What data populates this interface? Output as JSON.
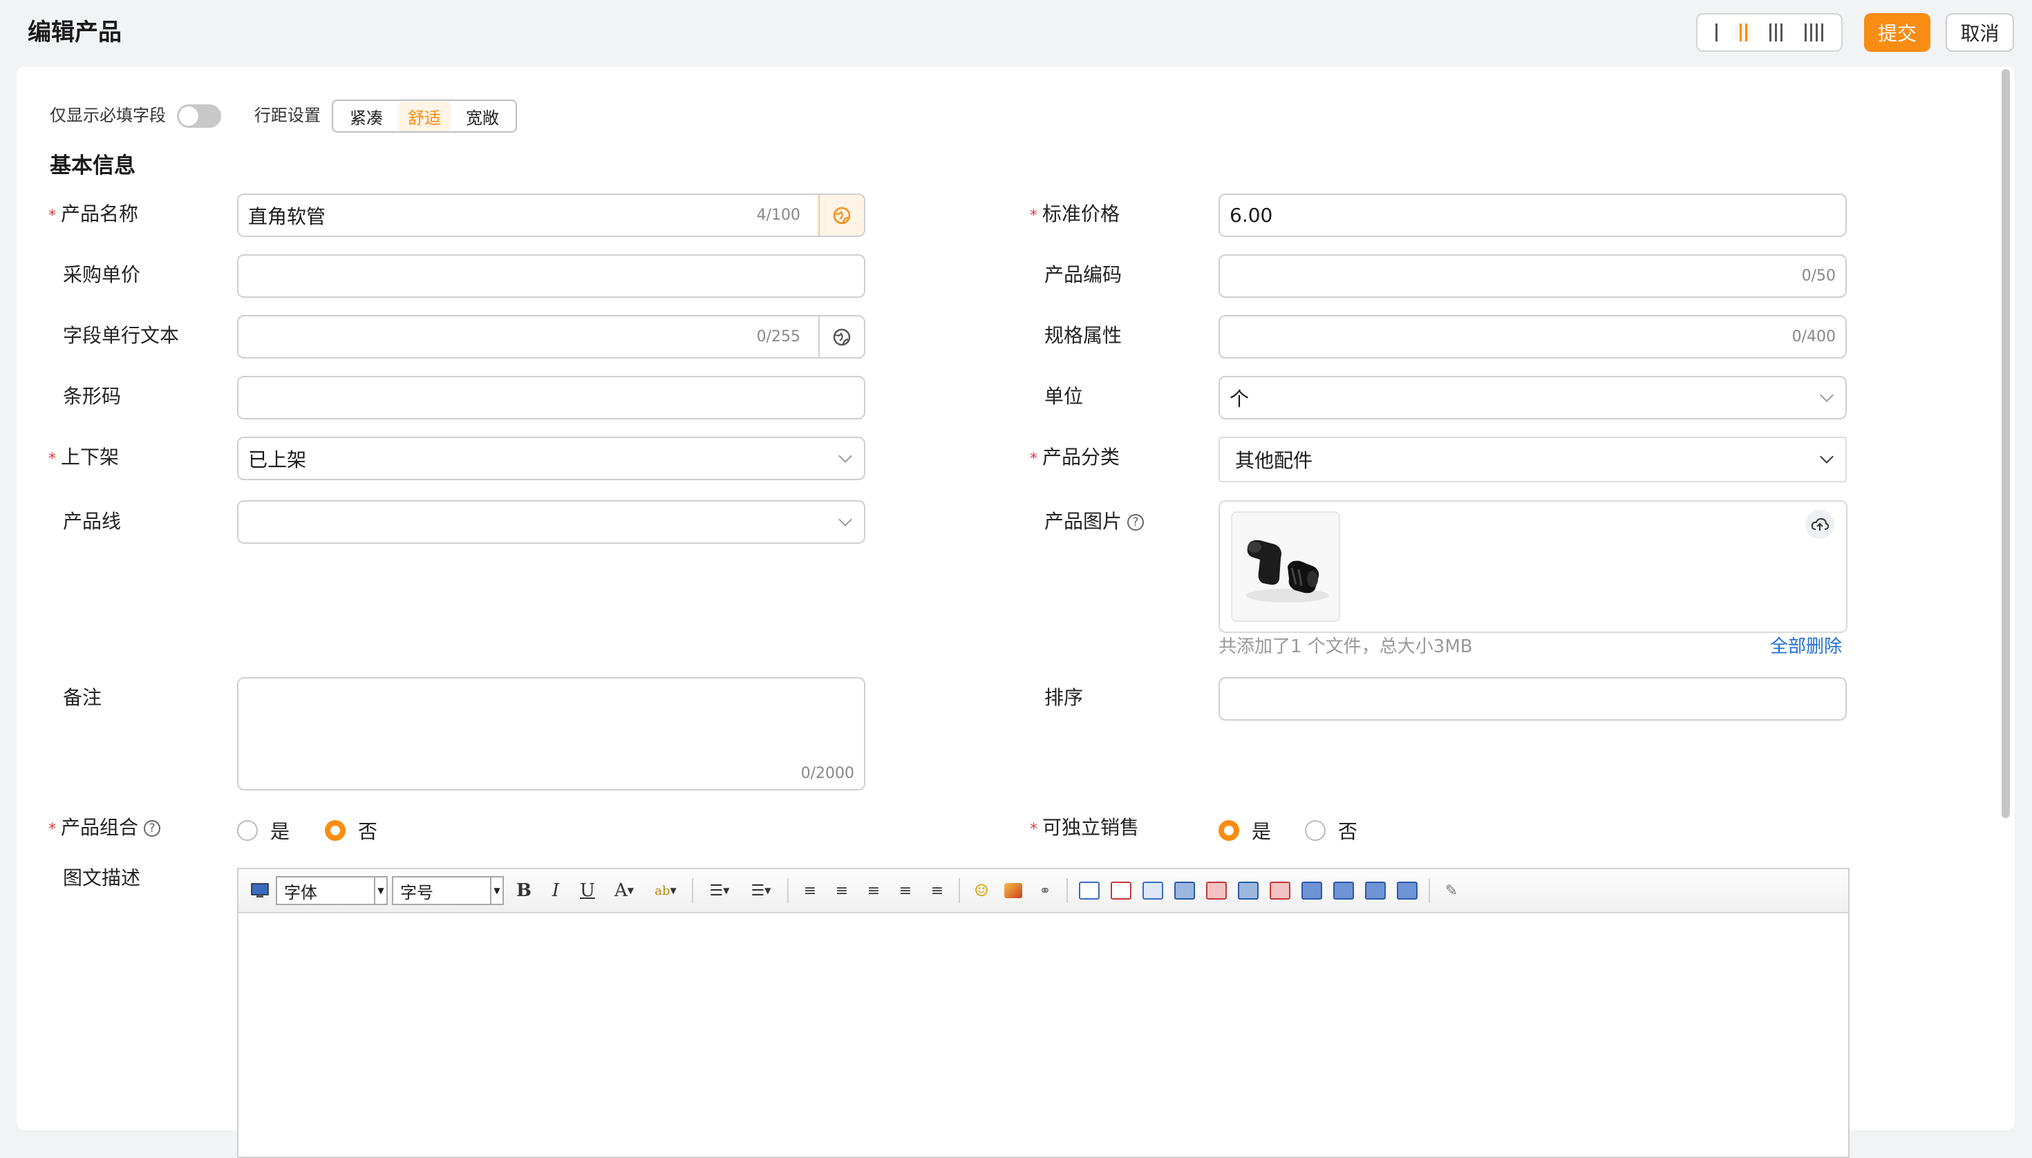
{
  "header": {
    "title": "编辑产品",
    "submit_label": "提交",
    "cancel_label": "取消"
  },
  "options": {
    "required_only_label": "仅显示必填字段",
    "spacing_label": "行距设置",
    "spacing_options": [
      "紧凑",
      "舒适",
      "宽敞"
    ],
    "spacing_selected": "舒适"
  },
  "section": {
    "title": "基本信息"
  },
  "fields": {
    "product_name": {
      "label": "产品名称",
      "value": "直角软管",
      "count": "4/100"
    },
    "purchase_price": {
      "label": "采购单价",
      "value": ""
    },
    "single_line_text": {
      "label": "字段单行文本",
      "value": "",
      "count": "0/255"
    },
    "barcode": {
      "label": "条形码",
      "value": ""
    },
    "listing_status": {
      "label": "上下架",
      "value": "已上架"
    },
    "product_line": {
      "label": "产品线",
      "value": ""
    },
    "remark": {
      "label": "备注",
      "value": "",
      "count": "0/2000"
    },
    "product_combo": {
      "label": "产品组合",
      "options": [
        "是",
        "否"
      ],
      "selected": "否"
    },
    "rich_description": {
      "label": "图文描述"
    },
    "standard_price": {
      "label": "标准价格",
      "value": "6.00"
    },
    "product_code": {
      "label": "产品编码",
      "value": "",
      "count": "0/50"
    },
    "spec_attr": {
      "label": "规格属性",
      "value": "",
      "count": "0/400"
    },
    "unit": {
      "label": "单位",
      "value": "个"
    },
    "category": {
      "label": "产品分类",
      "value": "其他配件"
    },
    "product_image": {
      "label": "产品图片",
      "file_info": "共添加了1 个文件，总大小3MB",
      "delete_all": "全部删除"
    },
    "sort_order": {
      "label": "排序",
      "value": ""
    },
    "sell_separately": {
      "label": "可独立销售",
      "options": [
        "是",
        "否"
      ],
      "selected": "是"
    }
  },
  "editor": {
    "font_placeholder": "字体",
    "size_placeholder": "字号"
  },
  "colors": {
    "accent": "#f98c12",
    "required": "#e23b3b",
    "link": "#1f6fd8"
  }
}
